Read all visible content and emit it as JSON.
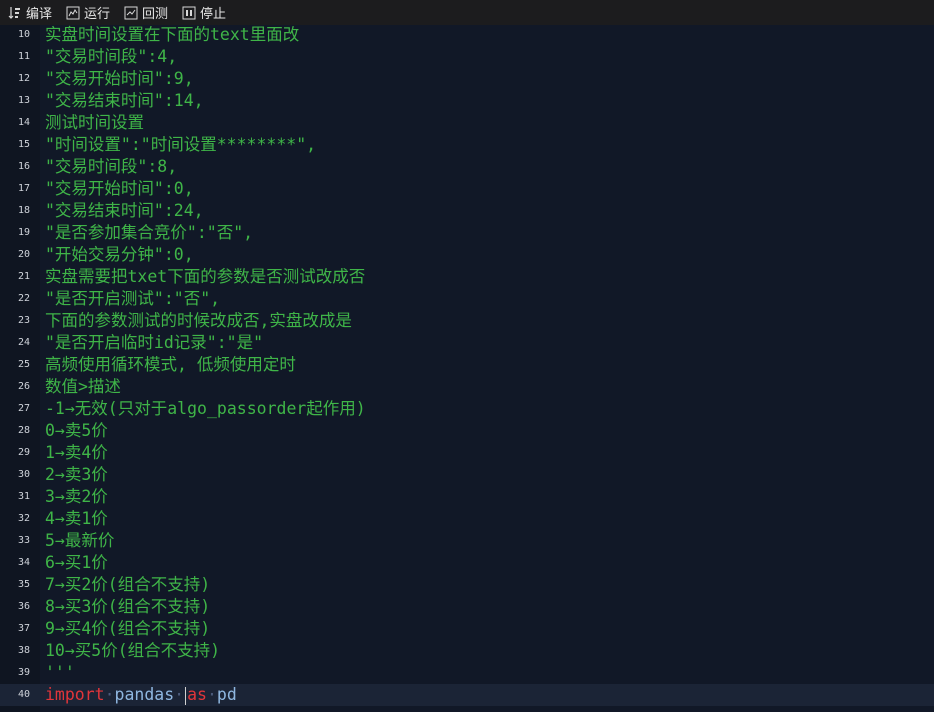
{
  "toolbar": {
    "compile_label": "编译",
    "run_label": "运行",
    "backtest_label": "回测",
    "stop_label": "停止"
  },
  "editor": {
    "lines": [
      {
        "num": "10",
        "text": "实盘时间设置在下面的text里面改"
      },
      {
        "num": "11",
        "text": "\"交易时间段\":4,"
      },
      {
        "num": "12",
        "text": "\"交易开始时间\":9,"
      },
      {
        "num": "13",
        "text": "\"交易结束时间\":14,"
      },
      {
        "num": "14",
        "text": "测试时间设置"
      },
      {
        "num": "15",
        "text": "\"时间设置\":\"时间设置********\","
      },
      {
        "num": "16",
        "text": "\"交易时间段\":8,"
      },
      {
        "num": "17",
        "text": "\"交易开始时间\":0,"
      },
      {
        "num": "18",
        "text": "\"交易结束时间\":24,"
      },
      {
        "num": "19",
        "text": "\"是否参加集合竞价\":\"否\","
      },
      {
        "num": "20",
        "text": "\"开始交易分钟\":0,"
      },
      {
        "num": "21",
        "text": "实盘需要把txet下面的参数是否测试改成否"
      },
      {
        "num": "22",
        "text": "\"是否开启测试\":\"否\","
      },
      {
        "num": "23",
        "text": "下面的参数测试的时候改成否,实盘改成是"
      },
      {
        "num": "24",
        "text": "\"是否开启临时id记录\":\"是\""
      },
      {
        "num": "25",
        "text": "高频使用循环模式, 低频使用定时"
      },
      {
        "num": "26",
        "text": "数值>描述"
      },
      {
        "num": "27",
        "text": "-1→无效(只对于algo_passorder起作用)"
      },
      {
        "num": "28",
        "text": "0→卖5价"
      },
      {
        "num": "29",
        "text": "1→卖4价"
      },
      {
        "num": "30",
        "text": "2→卖3价"
      },
      {
        "num": "31",
        "text": "3→卖2价"
      },
      {
        "num": "32",
        "text": "4→卖1价"
      },
      {
        "num": "33",
        "text": "5→最新价"
      },
      {
        "num": "34",
        "text": "6→买1价"
      },
      {
        "num": "35",
        "text": "7→买2价(组合不支持)"
      },
      {
        "num": "36",
        "text": "8→买3价(组合不支持)"
      },
      {
        "num": "37",
        "text": "9→买4价(组合不支持)"
      },
      {
        "num": "38",
        "text": "10→买5价(组合不支持)"
      },
      {
        "num": "39",
        "text": "'''"
      }
    ],
    "current_line": {
      "num": "40",
      "kw_import": "import",
      "mod": "pandas",
      "kw_as": "as",
      "alias": "pd"
    }
  }
}
